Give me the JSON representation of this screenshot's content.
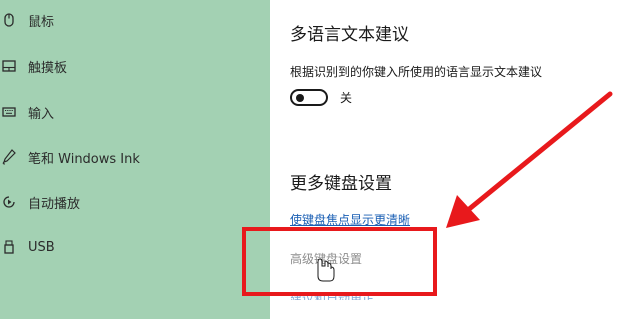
{
  "sidebar": {
    "items": [
      {
        "label": "鼠标",
        "icon": "mouse-icon"
      },
      {
        "label": "触摸板",
        "icon": "touchpad-icon"
      },
      {
        "label": "输入",
        "icon": "keyboard-icon"
      },
      {
        "label": "笔和 Windows Ink",
        "icon": "pen-icon"
      },
      {
        "label": "自动播放",
        "icon": "autoplay-icon"
      },
      {
        "label": "USB",
        "icon": "usb-icon"
      }
    ]
  },
  "main": {
    "multilang": {
      "heading": "多语言文本建议",
      "description": "根据识别到的你键入所使用的语言显示文本建议",
      "toggle_state": "关"
    },
    "more_keyboard": {
      "heading": "更多键盘设置",
      "links": [
        "使键盘焦点显示更清晰",
        "高级键盘设置",
        "建议和自动更正"
      ]
    }
  },
  "colors": {
    "sidebar_bg": "#a3d1b3",
    "link": "#1a5fb4",
    "annotation_red": "#e8191c"
  }
}
